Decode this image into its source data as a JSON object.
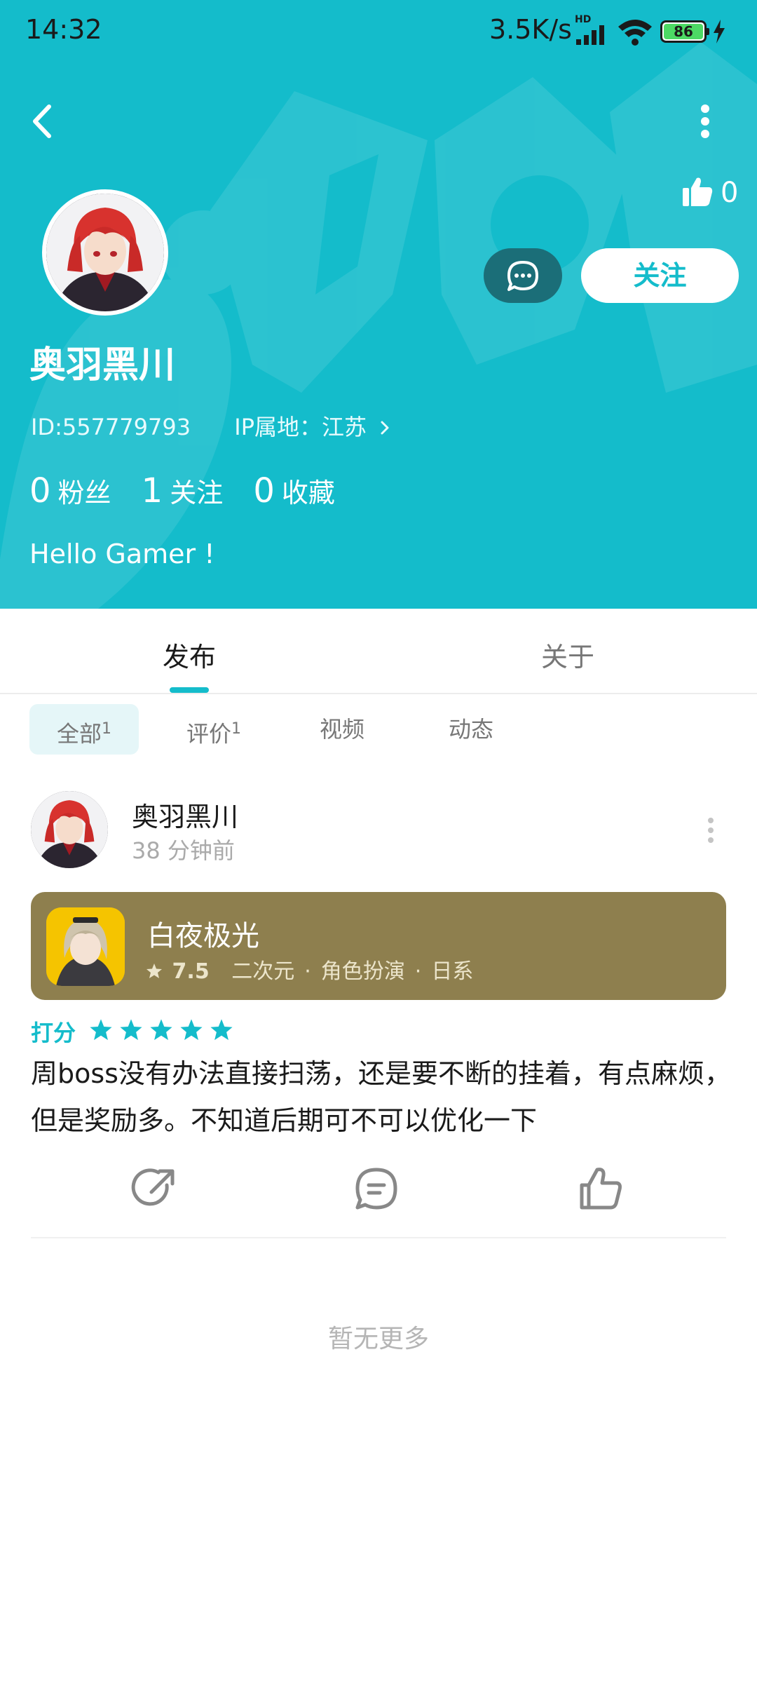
{
  "status_bar": {
    "time": "14:32",
    "network_speed": "3.5K/s",
    "hd_label": "HD",
    "battery": "86"
  },
  "header": {
    "like_count": "0",
    "follow_label": "关注",
    "user_name": "奥羽黑川",
    "user_id": "ID:557779793",
    "ip_location": "IP属地：江苏",
    "stats": [
      {
        "num": "0",
        "label": "粉丝"
      },
      {
        "num": "1",
        "label": "关注"
      },
      {
        "num": "0",
        "label": "收藏"
      }
    ],
    "bio": "Hello Gamer !"
  },
  "tabs": {
    "publish": "发布",
    "about": "关于"
  },
  "filters": {
    "all": "全部",
    "all_count": "1",
    "review": "评价",
    "review_count": "1",
    "video": "视频",
    "moment": "动态"
  },
  "post": {
    "author": "奥羽黑川",
    "time": "38 分钟前",
    "game": {
      "name": "白夜极光",
      "score": "7.5",
      "tags": [
        "二次元",
        "角色扮演",
        "日系"
      ]
    },
    "rating_label": "打分",
    "rating_stars": 5,
    "content": "周boss没有办法直接扫荡，还是要不断的挂着，有点麻烦，但是奖励多。不知道后期可不可以优化一下"
  },
  "footer": {
    "no_more": "暂无更多"
  },
  "colors": {
    "header_bg": "#14bccb",
    "accent": "#14bccb",
    "game_card_bg": "#8e7f4e",
    "message_button_bg": "#1b6e78"
  }
}
